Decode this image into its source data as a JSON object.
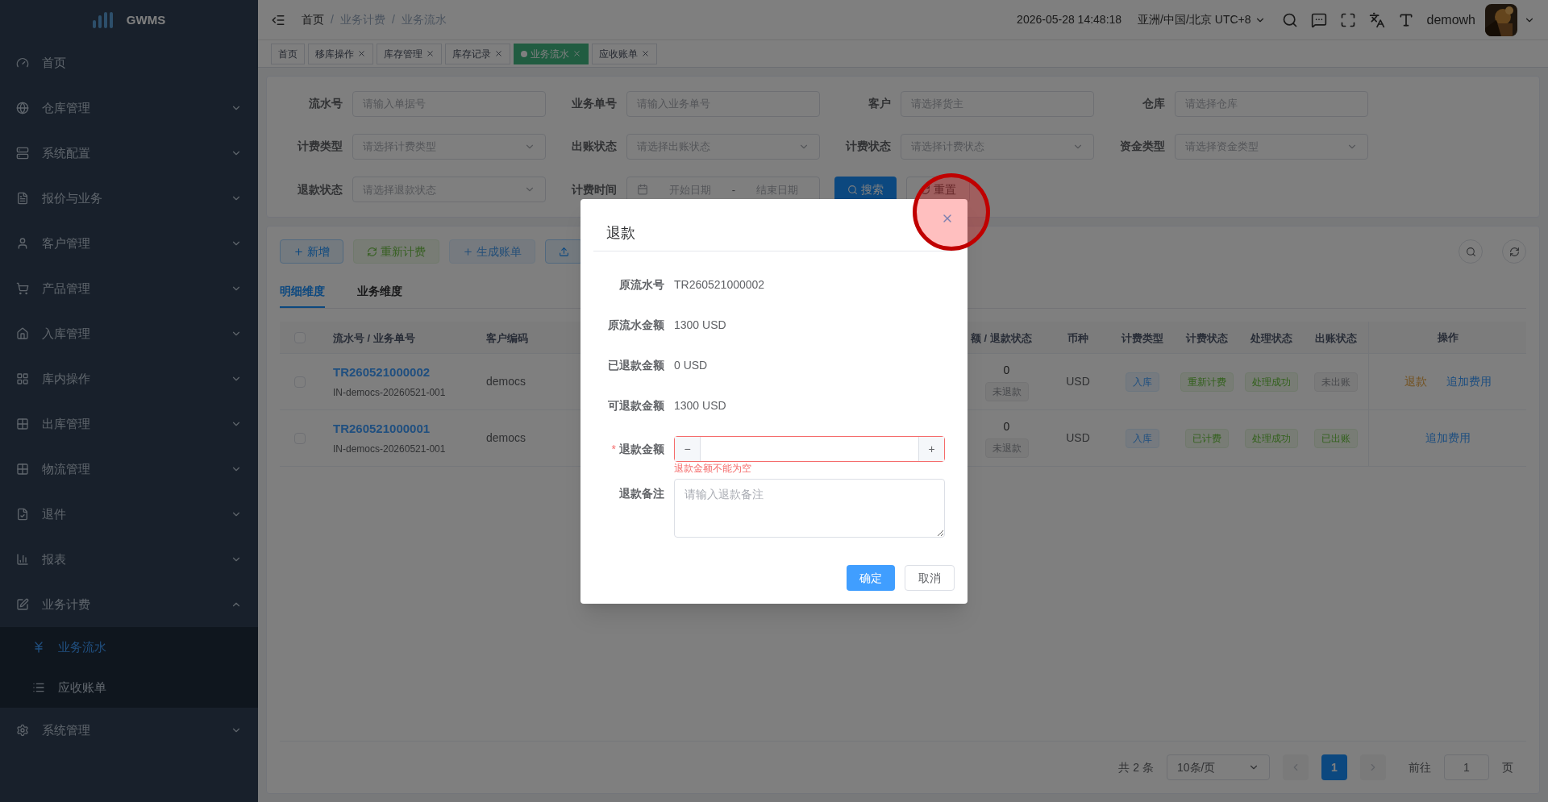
{
  "sidebar": {
    "logo": "GWMS",
    "items": [
      {
        "label": "首页"
      },
      {
        "label": "仓库管理",
        "expanded": false
      },
      {
        "label": "系统配置",
        "expanded": false
      },
      {
        "label": "报价与业务",
        "expanded": false
      },
      {
        "label": "客户管理",
        "expanded": false
      },
      {
        "label": "产品管理",
        "expanded": false
      },
      {
        "label": "入库管理",
        "expanded": false
      },
      {
        "label": "库内操作",
        "expanded": false
      },
      {
        "label": "出库管理",
        "expanded": false
      },
      {
        "label": "物流管理",
        "expanded": false
      },
      {
        "label": "退件",
        "expanded": false
      },
      {
        "label": "报表",
        "expanded": false
      },
      {
        "label": "业务计费",
        "expanded": true,
        "children": [
          {
            "label": "业务流水",
            "selected": true
          },
          {
            "label": "应收账单",
            "selected": false
          }
        ]
      },
      {
        "label": "系统管理",
        "expanded": false
      }
    ]
  },
  "header": {
    "breadcrumb": [
      "首页",
      "/",
      "业务计费",
      "/",
      "业务流水"
    ],
    "datetime": "2026-05-28 14:48:18",
    "timezone": "亚洲/中国/北京 UTC+8",
    "username": "demowh"
  },
  "page_tabs": [
    {
      "label": "首页",
      "selected": false,
      "closable": false
    },
    {
      "label": "移库操作",
      "selected": false,
      "closable": true
    },
    {
      "label": "库存管理",
      "selected": false,
      "closable": true
    },
    {
      "label": "库存记录",
      "selected": false,
      "closable": true
    },
    {
      "label": "业务流水",
      "selected": true,
      "closable": true
    },
    {
      "label": "应收账单",
      "selected": false,
      "closable": true
    }
  ],
  "filters": [
    {
      "label": "流水号",
      "kind": "input",
      "placeholder": "请输入单据号"
    },
    {
      "label": "业务单号",
      "kind": "input",
      "placeholder": "请输入业务单号"
    },
    {
      "label": "客户",
      "kind": "input",
      "placeholder": "请选择货主"
    },
    {
      "label": "仓库",
      "kind": "input",
      "placeholder": "请选择仓库"
    },
    {
      "label": "计费类型",
      "kind": "select",
      "placeholder": "请选择计费类型"
    },
    {
      "label": "出账状态",
      "kind": "select",
      "placeholder": "请选择出账状态"
    },
    {
      "label": "计费状态",
      "kind": "select",
      "placeholder": "请选择计费状态"
    },
    {
      "label": "资金类型",
      "kind": "select",
      "placeholder": "请选择资金类型"
    },
    {
      "label": "退款状态",
      "kind": "select",
      "placeholder": "请选择退款状态"
    },
    {
      "label": "计费时间",
      "kind": "daterange",
      "start_placeholder": "开始日期",
      "separator": "-",
      "end_placeholder": "结束日期"
    }
  ],
  "filter_buttons": [
    {
      "label": "搜索",
      "kind": "primary"
    },
    {
      "label": "重置",
      "kind": "default"
    }
  ],
  "toolbar": [
    {
      "label": "新增",
      "kind": "add",
      "disabled": false
    },
    {
      "label": "重新计费",
      "kind": "recalc",
      "disabled": true
    },
    {
      "label": "生成账单",
      "kind": "add",
      "disabled": true
    },
    {
      "kind": "upload",
      "disabled": false
    }
  ],
  "view_tabs": [
    {
      "label": "明细维度",
      "selected": true
    },
    {
      "label": "业务维度",
      "selected": false
    }
  ],
  "table": {
    "select_all_checked": false,
    "columns": [
      "流水号 / 业务单号",
      "客户编码",
      "额 / 退款状态",
      "币种",
      "计费类型",
      "计费状态",
      "处理状态",
      "出账状态",
      "操作"
    ],
    "rows": [
      {
        "checked": false,
        "serial": "TR260521000002",
        "business_no": "IN-democs-20260521-001",
        "customer": "democs",
        "amount": "0",
        "refund_status": "未退款",
        "currency": "USD",
        "fee_type": "入库",
        "fee_status": {
          "label": "重新计费",
          "kind": "success"
        },
        "process_status": {
          "label": "处理成功",
          "kind": "success"
        },
        "bill_status": {
          "label": "未出账",
          "kind": "info"
        },
        "actions": [
          {
            "label": "退款",
            "kind": "warning"
          },
          {
            "label": "追加费用",
            "kind": "primary"
          }
        ]
      },
      {
        "checked": false,
        "serial": "TR260521000001",
        "business_no": "IN-democs-20260521-001",
        "customer": "democs",
        "amount": "0",
        "refund_status": "未退款",
        "currency": "USD",
        "fee_type": "入库",
        "fee_status": {
          "label": "已计费",
          "kind": "success"
        },
        "process_status": {
          "label": "处理成功",
          "kind": "success"
        },
        "bill_status": {
          "label": "已出账",
          "kind": "success"
        },
        "actions": [
          {
            "label": "追加费用",
            "kind": "primary"
          }
        ]
      }
    ]
  },
  "pagination": {
    "total": "共 2 条",
    "page_size": "10条/页",
    "pages": [
      {
        "label": "1",
        "selected": true
      }
    ],
    "goto_label": "前往",
    "goto_value": "1",
    "page_suffix": "页"
  },
  "dialog": {
    "title": "退款",
    "info": [
      {
        "label": "原流水号",
        "value": "TR260521000002"
      },
      {
        "label": "原流水金额",
        "value": "1300 USD"
      },
      {
        "label": "已退款金额",
        "value": "0 USD"
      },
      {
        "label": "可退款金额",
        "value": "1300 USD"
      }
    ],
    "amount_field": {
      "label": "退款金额",
      "required": true,
      "required_mark": "*",
      "minus": "−",
      "plus": "+",
      "error": "退款金额不能为空"
    },
    "remark_field": {
      "label": "退款备注",
      "placeholder": "请输入退款备注"
    },
    "buttons": [
      {
        "label": "确定",
        "kind": "primary"
      },
      {
        "label": "取消",
        "kind": "default"
      }
    ],
    "highlight_close": true
  }
}
